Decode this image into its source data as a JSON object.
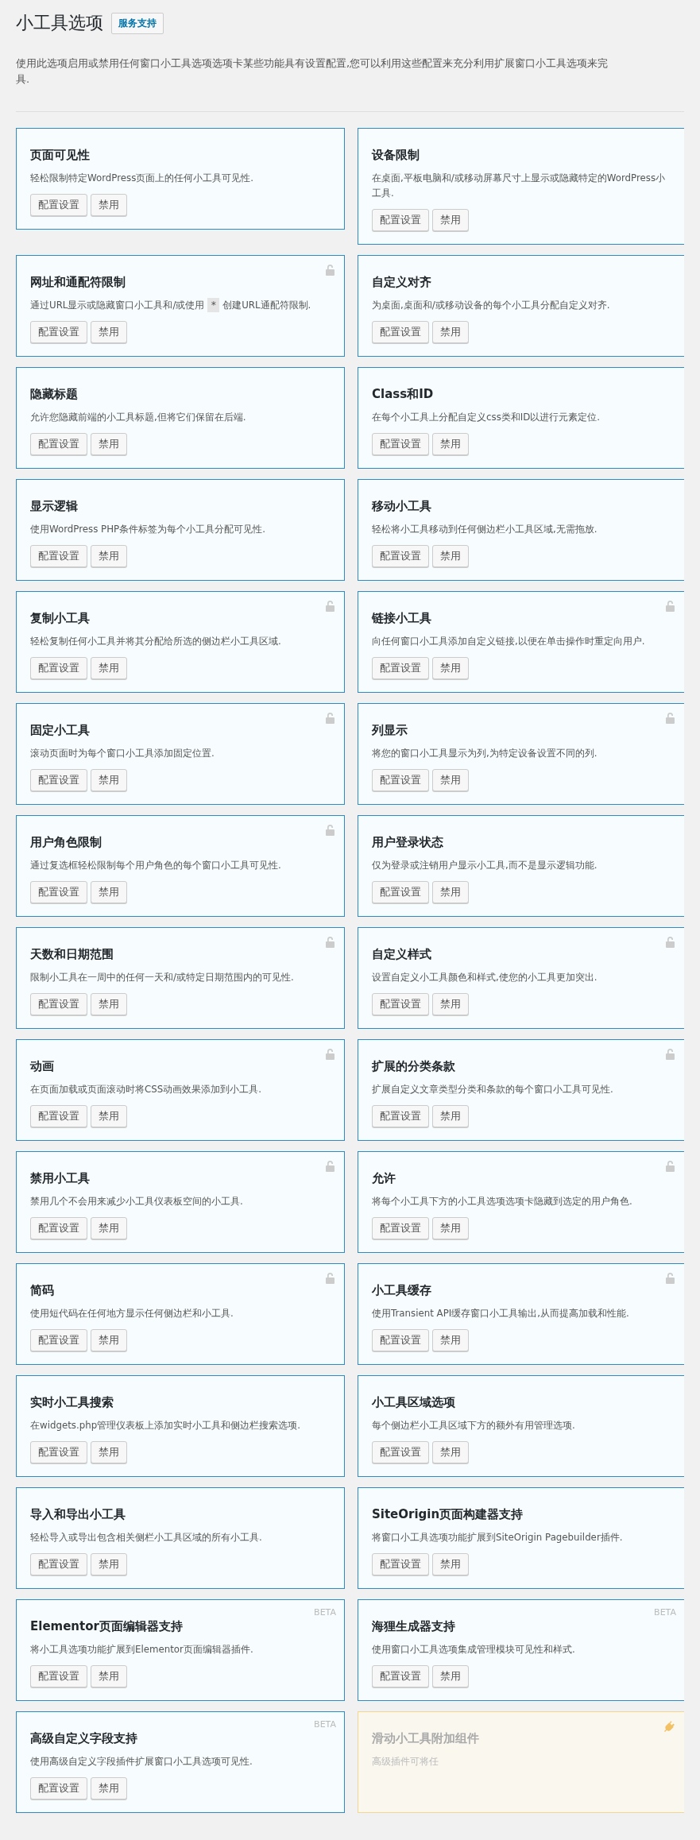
{
  "header": {
    "title": "小工具选项",
    "support_button": "服务支持",
    "description_lines": [
      "使用此选项启用或禁用任何窗口小工具选项选项卡某些功能具有设置配置,您可以利用这些配置来充分利用扩展窗口小工具选项来完",
      "具."
    ]
  },
  "cards": [
    {
      "kind": "module",
      "title": "页面可见性",
      "description": "轻松限制特定WordPress页面上的任何小工具可见性.",
      "buttons": [
        "配置设置",
        "禁用"
      ]
    },
    {
      "kind": "module",
      "title": "设备限制",
      "description": "在桌面,平板电脑和/或移动屏幕尺寸上显示或隐藏特定的WordPress小工具.",
      "buttons": [
        "配置设置",
        "禁用"
      ]
    },
    {
      "kind": "module",
      "locked": true,
      "title": "网址和通配符限制",
      "description": "通过URL显示或隐藏窗口小工具和/或使用",
      "code": "*",
      "description_end": "创建URL通配符限制.",
      "buttons": [
        "配置设置",
        "禁用"
      ]
    },
    {
      "kind": "module",
      "title": "自定义对齐",
      "description": "为桌面,桌面和/或移动设备的每个小工具分配自定义对齐.",
      "buttons": [
        "配置设置",
        "禁用"
      ]
    },
    {
      "kind": "module",
      "title": "隐藏标题",
      "description": "允许您隐藏前端的小工具标题,但将它们保留在后端.",
      "buttons": [
        "配置设置",
        "禁用"
      ]
    },
    {
      "kind": "module",
      "title": "Class和ID",
      "description": "在每个小工具上分配自定义css类和ID以进行元素定位.",
      "buttons": [
        "配置设置",
        "禁用"
      ]
    },
    {
      "kind": "module",
      "title": "显示逻辑",
      "description": "使用WordPress PHP条件标签为每个小工具分配可见性.",
      "buttons": [
        "配置设置",
        "禁用"
      ]
    },
    {
      "kind": "module",
      "title": "移动小工具",
      "description": "轻松将小工具移动到任何侧边栏小工具区域,无需拖放.",
      "buttons": [
        "配置设置",
        "禁用"
      ]
    },
    {
      "kind": "module",
      "locked": true,
      "title": "复制小工具",
      "description": "轻松复制任何小工具并将其分配给所选的侧边栏小工具区域.",
      "buttons": [
        "配置设置",
        "禁用"
      ]
    },
    {
      "kind": "module",
      "locked": true,
      "title": "链接小工具",
      "description": "向任何窗口小工具添加自定义链接,以便在单击操作时重定向用户.",
      "buttons": [
        "配置设置",
        "禁用"
      ]
    },
    {
      "kind": "module",
      "locked": true,
      "title": "固定小工具",
      "description": "滚动页面时为每个窗口小工具添加固定位置.",
      "buttons": [
        "配置设置",
        "禁用"
      ]
    },
    {
      "kind": "module",
      "locked": true,
      "title": "列显示",
      "description": "将您的窗口小工具显示为列,为特定设备设置不同的列.",
      "buttons": [
        "配置设置",
        "禁用"
      ]
    },
    {
      "kind": "module",
      "locked": true,
      "title": "用户角色限制",
      "description": "通过复选框轻松限制每个用户角色的每个窗口小工具可见性.",
      "buttons": [
        "配置设置",
        "禁用"
      ]
    },
    {
      "kind": "module",
      "title": "用户登录状态",
      "description": "仅为登录或注销用户显示小工具,而不是显示逻辑功能.",
      "buttons": [
        "配置设置",
        "禁用"
      ]
    },
    {
      "kind": "module",
      "locked": true,
      "title": "天数和日期范围",
      "description": "限制小工具在一周中的任何一天和/或特定日期范围内的可见性.",
      "buttons": [
        "配置设置",
        "禁用"
      ]
    },
    {
      "kind": "module",
      "locked": true,
      "title": "自定义样式",
      "description": "设置自定义小工具颜色和样式,使您的小工具更加突出.",
      "buttons": [
        "配置设置",
        "禁用"
      ]
    },
    {
      "kind": "module",
      "locked": true,
      "title": "动画",
      "description": "在页面加载或页面滚动时将CSS动画效果添加到小工具.",
      "buttons": [
        "配置设置",
        "禁用"
      ]
    },
    {
      "kind": "module",
      "locked": true,
      "title": "扩展的分类条款",
      "description": "扩展自定义文章类型分类和条款的每个窗口小工具可见性.",
      "buttons": [
        "配置设置",
        "禁用"
      ]
    },
    {
      "kind": "module",
      "locked": true,
      "title": "禁用小工具",
      "description": "禁用几个不会用来减少小工具仪表板空间的小工具.",
      "buttons": [
        "配置设置",
        "禁用"
      ]
    },
    {
      "kind": "module",
      "locked": true,
      "title": "允许",
      "description": "将每个小工具下方的小工具选项选项卡隐藏到选定的用户角色.",
      "buttons": [
        "配置设置",
        "禁用"
      ]
    },
    {
      "kind": "module",
      "locked": true,
      "title": "简码",
      "description": "使用短代码在任何地方显示任何侧边栏和小工具.",
      "buttons": [
        "配置设置",
        "禁用"
      ]
    },
    {
      "kind": "module",
      "locked": true,
      "title": "小工具缓存",
      "description": "使用Transient API缓存窗口小工具输出,从而提高加载和性能.",
      "buttons": [
        "配置设置",
        "禁用"
      ]
    },
    {
      "kind": "module",
      "title": "实时小工具搜索",
      "description": "在widgets.php管理仪表板上添加实时小工具和侧边栏搜索选项.",
      "buttons": [
        "配置设置",
        "禁用"
      ]
    },
    {
      "kind": "module",
      "title": "小工具区域选项",
      "description": "每个侧边栏小工具区域下方的额外有用管理选项.",
      "buttons": [
        "配置设置",
        "禁用"
      ]
    },
    {
      "kind": "module",
      "title": "导入和导出小工具",
      "description": "轻松导入或导出包含相关侧栏小工具区域的所有小工具.",
      "buttons": [
        "配置设置",
        "禁用"
      ]
    },
    {
      "kind": "module",
      "title": "SiteOrigin页面构建器支持",
      "description": "将窗口小工具选项功能扩展到SiteOrigin Pagebuilder插件.",
      "buttons": [
        "配置设置",
        "禁用"
      ]
    },
    {
      "kind": "module",
      "badge": "BETA",
      "title": "Elementor页面编辑器支持",
      "description": "将小工具选项功能扩展到Elementor页面编辑器插件.",
      "buttons": [
        "配置设置",
        "禁用"
      ]
    },
    {
      "kind": "module",
      "badge": "BETA",
      "title": "海狸生成器支持",
      "description": "使用窗口小工具选项集成管理模块可见性和样式.",
      "buttons": [
        "配置设置",
        "禁用"
      ]
    },
    {
      "kind": "module",
      "badge": "BETA",
      "title": "高级自定义字段支持",
      "description": "使用高级自定义字段插件扩展窗口小工具选项可见性.",
      "buttons": [
        "配置设置",
        "禁用"
      ]
    },
    {
      "kind": "addon",
      "title": "滑动小工具附加组件",
      "description": "高级插件可将任"
    }
  ]
}
